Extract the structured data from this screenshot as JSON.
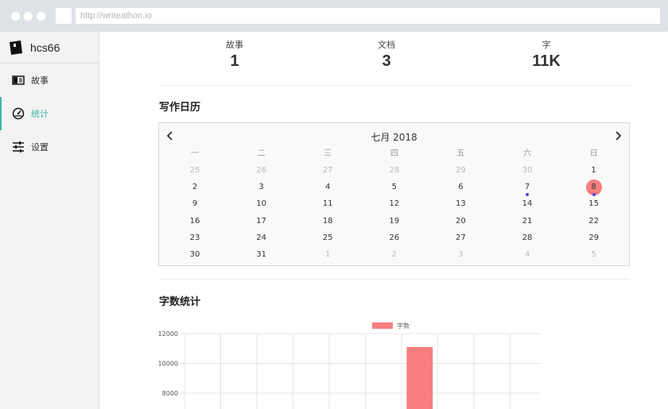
{
  "browser": {
    "url": "http://writeathon.io"
  },
  "sidebar": {
    "brand": "hcs66",
    "items": [
      {
        "label": "故事",
        "icon": "book-icon",
        "active": false
      },
      {
        "label": "统计",
        "icon": "dashboard-icon",
        "active": true
      },
      {
        "label": "设置",
        "icon": "sliders-icon",
        "active": false
      }
    ]
  },
  "stats": [
    {
      "label": "故事",
      "value": "1"
    },
    {
      "label": "文档",
      "value": "3"
    },
    {
      "label": "字",
      "value": "11K"
    }
  ],
  "calendar_section": {
    "title": "写作日历"
  },
  "calendar": {
    "month_label": "七月 2018",
    "weekdays": [
      "一",
      "二",
      "三",
      "四",
      "五",
      "六",
      "日"
    ],
    "weeks": [
      [
        "25",
        "26",
        "27",
        "28",
        "29",
        "30",
        "1"
      ],
      [
        "2",
        "3",
        "4",
        "5",
        "6",
        "7",
        "8"
      ],
      [
        "9",
        "10",
        "11",
        "12",
        "13",
        "14",
        "15"
      ],
      [
        "16",
        "17",
        "18",
        "19",
        "20",
        "21",
        "22"
      ],
      [
        "23",
        "24",
        "25",
        "26",
        "27",
        "28",
        "29"
      ],
      [
        "30",
        "31",
        "1",
        "2",
        "3",
        "4",
        "5"
      ]
    ],
    "muted": [
      [
        0,
        0
      ],
      [
        0,
        1
      ],
      [
        0,
        2
      ],
      [
        0,
        3
      ],
      [
        0,
        4
      ],
      [
        0,
        5
      ],
      [
        5,
        2
      ],
      [
        5,
        3
      ],
      [
        5,
        4
      ],
      [
        5,
        5
      ],
      [
        5,
        6
      ]
    ],
    "today": [
      1,
      6
    ],
    "marked": [
      [
        1,
        5
      ],
      [
        1,
        6
      ]
    ],
    "accent": "#f57e7e",
    "mark_color": "#4f46e5"
  },
  "wordcount_section": {
    "title": "字数统计"
  },
  "chart_data": {
    "type": "bar",
    "legend": "字数",
    "legend_placement": "top-center",
    "bar_color": "#f77e7e",
    "y_ticks": [
      8000,
      10000,
      12000
    ],
    "ylim_visible": [
      8000,
      12000
    ],
    "category_count": 12,
    "values": [
      0,
      0,
      0,
      0,
      0,
      0,
      11100,
      0,
      0,
      0,
      0,
      0
    ]
  }
}
